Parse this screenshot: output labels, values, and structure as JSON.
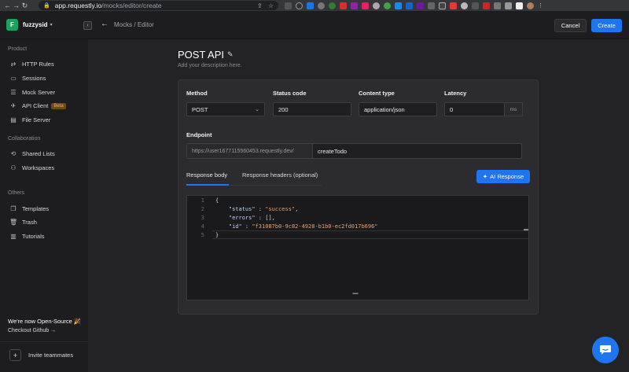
{
  "browser": {
    "url_domain": "app.requestly.io",
    "url_path": "/mocks/editor/create"
  },
  "workspace": {
    "initial": "F",
    "name": "fuzzysid"
  },
  "breadcrumb": {
    "parent": "Mocks",
    "separator": "/",
    "current": "Editor"
  },
  "header_actions": {
    "cancel_label": "Cancel",
    "create_label": "Create"
  },
  "sidebar": {
    "sections": [
      {
        "title": "Product",
        "items": [
          {
            "label": "HTTP Rules",
            "icon": "http-rules-icon"
          },
          {
            "label": "Sessions",
            "icon": "video-icon"
          },
          {
            "label": "Mock Server",
            "icon": "server-icon"
          },
          {
            "label": "API Client",
            "icon": "rocket-icon",
            "badge": "Beta"
          },
          {
            "label": "File Server",
            "icon": "file-icon"
          }
        ]
      },
      {
        "title": "Collaboration",
        "items": [
          {
            "label": "Shared Lists",
            "icon": "share-icon"
          },
          {
            "label": "Workspaces",
            "icon": "users-icon"
          }
        ]
      },
      {
        "title": "Others",
        "items": [
          {
            "label": "Templates",
            "icon": "template-icon"
          },
          {
            "label": "Trash",
            "icon": "trash-icon"
          },
          {
            "label": "Tutorials",
            "icon": "book-icon"
          }
        ]
      }
    ],
    "open_source_title": "We're now Open-Source 🎉",
    "github_link": "Checkout Github →",
    "invite_label": "Invite teammates"
  },
  "mock": {
    "title": "POST API",
    "description_placeholder": "Add your description here.",
    "method_label": "Method",
    "method_value": "POST",
    "status_label": "Status code",
    "status_value": "200",
    "content_type_label": "Content type",
    "content_type_value": "application/json",
    "latency_label": "Latency",
    "latency_value": "0",
    "latency_unit": "ms",
    "endpoint_label": "Endpoint",
    "endpoint_prefix": "https://user1677115560453.requestly.dev/",
    "endpoint_value": "createTodo",
    "tabs": [
      "Response body",
      "Response headers (optional)"
    ],
    "ai_button_label": "AI Response",
    "code_lines": [
      {
        "n": "1",
        "t": "{"
      },
      {
        "n": "2",
        "k": "\"status\"",
        "s": "\"success\"",
        "tail": ","
      },
      {
        "n": "3",
        "k": "\"errors\"",
        "p": "[]",
        "tail": ","
      },
      {
        "n": "4",
        "k": "\"id\"",
        "s": "\"f31087b0-9c82-4928-b1b0-ec2fd017b696\"",
        "tail": ""
      },
      {
        "n": "5",
        "t": "}"
      }
    ]
  },
  "colors": {
    "accent": "#1f75f0",
    "workspace": "#19a35c",
    "beta_badge": "#f0b24a",
    "string": "#e6a274"
  }
}
